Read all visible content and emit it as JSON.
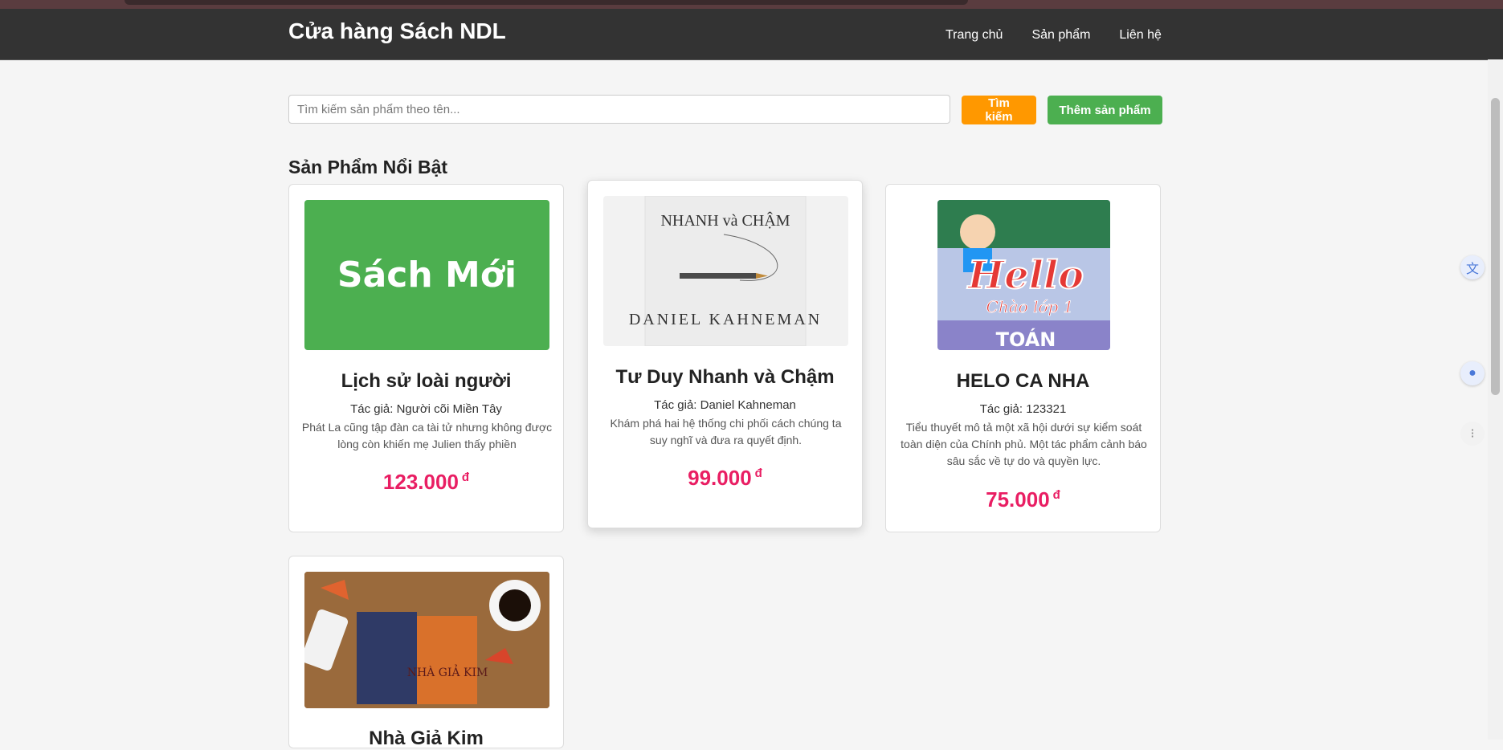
{
  "nav": {
    "brand": "Cửa hàng Sách NDL",
    "links": [
      "Trang chủ",
      "Sản phẩm",
      "Liên hệ"
    ]
  },
  "search": {
    "placeholder": "Tìm kiếm sản phẩm theo tên...",
    "value": "",
    "search_label": "Tìm kiếm",
    "add_label": "Thêm sản phẩm"
  },
  "section_title": "Sản Phẩm Nổi Bật",
  "products": [
    {
      "image_text": "Sách Mới",
      "title": "Lịch sử loài người",
      "author": "Tác giả: Người cõi Miền Tây",
      "description": "Phát La cũng tập đàn ca tài tử nhưng không được lòng còn khiến mẹ Julien thấy phiền",
      "price": "123.000",
      "currency": "đ"
    },
    {
      "image_text": "NHANH và CHẬM",
      "image_subtext": "DANIEL KAHNEMAN",
      "title": "Tư Duy Nhanh và Chậm",
      "author": "Tác giả: Daniel Kahneman",
      "description": "Khám phá hai hệ thống chi phối cách chúng ta suy nghĩ và đưa ra quyết định.",
      "price": "99.000",
      "currency": "đ"
    },
    {
      "image_text": "Hello",
      "image_subtext": "Chào lớp 1",
      "image_subtext2": "TOÁN",
      "title": "HELO CA NHA",
      "author": "Tác giả: 123321",
      "description": "Tiểu thuyết mô tả một xã hội dưới sự kiểm soát toàn diện của Chính phủ. Một tác phẩm cảnh báo sâu sắc về tự do và quyền lực.",
      "price": "75.000",
      "currency": "đ"
    },
    {
      "image_text": "NHÀ GIẢ KIM",
      "title": "Nhà Giả Kim"
    }
  ],
  "colors": {
    "navbar": "#333333",
    "search_button": "#ff9800",
    "add_button": "#4caf50",
    "price": "#e91e63",
    "new_book_tile": "#4caf50"
  },
  "icons": [
    "translate-icon",
    "water-drop-icon",
    "extension-icon"
  ]
}
